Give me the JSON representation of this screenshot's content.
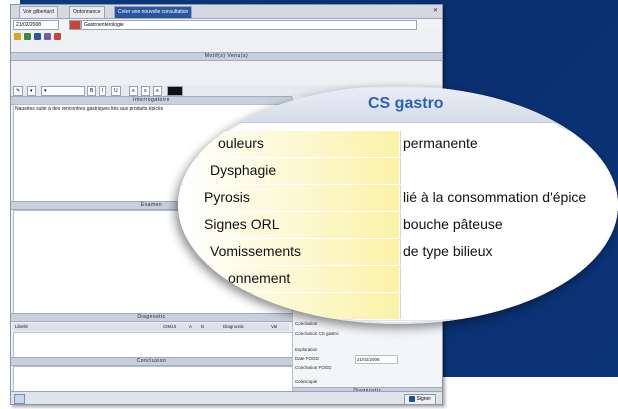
{
  "app": {
    "tabs": [
      "Voir gilbertard",
      "Ordonnance",
      "Créer une nouvelle consultation"
    ],
    "date": "21/02/2008",
    "row_field": "Gastroentérologie",
    "section_motif": "Motif(s) Venu(s)",
    "section_interrogatoire": "Interrogatoire",
    "editor_text": "Nausées suite à des rencontres gastriques liés aux produits épicés",
    "section_examen": "Examen",
    "section_diagnostic": "Diagnostic",
    "diagnostic_columns": [
      "Libellé",
      "CIM10",
      "A",
      "D",
      "Diagnostic",
      "Val"
    ],
    "section_conclusion": "Conclusion",
    "right_panel": {
      "rows": [
        {
          "label": "Conclusion",
          "value": ""
        },
        {
          "label": "Conclusion CS gastro",
          "value": ""
        },
        {
          "label": "Exploration",
          "value": ""
        },
        {
          "label": "Date FOGD",
          "value": "21/02/2008"
        },
        {
          "label": "Conclusion FOGD",
          "value": ""
        },
        {
          "label": "Coloscopie",
          "value": ""
        }
      ],
      "footer": "Diagnostic"
    },
    "sign_button": "Signer"
  },
  "lens": {
    "title": "CS gastro",
    "rows": [
      {
        "label": "ouleurs",
        "value": "permanente"
      },
      {
        "label": "Dysphagie",
        "value": ""
      },
      {
        "label": "Pyrosis",
        "value": "lié à la consommation d'épice"
      },
      {
        "label": "Signes ORL",
        "value": "bouche pâteuse"
      },
      {
        "label": "Vomissements",
        "value": "de type bilieux"
      },
      {
        "label": "onnement",
        "value": ""
      },
      {
        "label": "",
        "value": ""
      }
    ]
  },
  "colors": {
    "background": "#0b3478",
    "accent": "#2a62b8",
    "highlight": "#fbf2a6"
  }
}
